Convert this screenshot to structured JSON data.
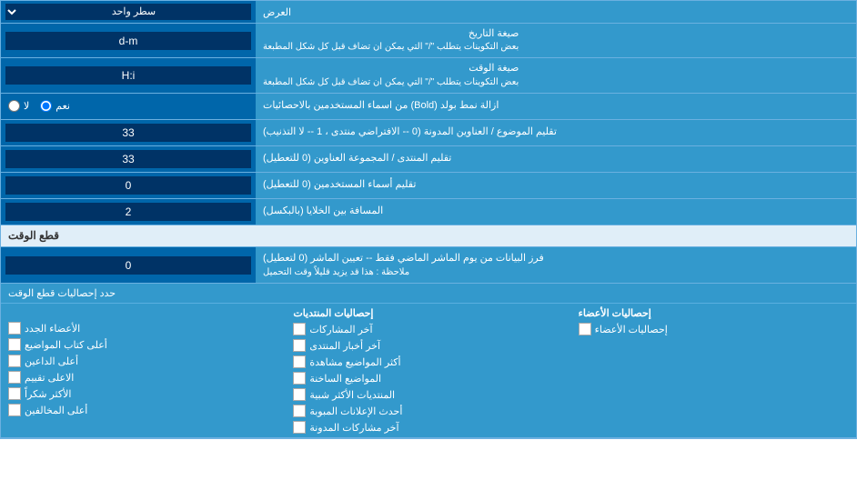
{
  "page": {
    "title": "العرض",
    "rows": [
      {
        "id": "display_mode",
        "label": "العرض",
        "input_type": "select",
        "value": "سطر واحد"
      },
      {
        "id": "date_format",
        "label": "صيغة التاريخ",
        "sublabel": "بعض التكوينات يتطلب \"/\" التي يمكن ان تضاف قبل كل شكل المطبعة",
        "input_type": "text",
        "value": "d-m"
      },
      {
        "id": "time_format",
        "label": "صيغة الوقت",
        "sublabel": "بعض التكوينات يتطلب \"/\" التي يمكن ان تضاف قبل كل شكل المطبعة",
        "input_type": "text",
        "value": "H:i"
      },
      {
        "id": "bold_remove",
        "label": "ازالة نمط بولد (Bold) من اسماء المستخدمين بالاحصائيات",
        "input_type": "radio",
        "options": [
          {
            "value": "yes",
            "label": "نعم",
            "checked": true
          },
          {
            "value": "no",
            "label": "لا",
            "checked": false
          }
        ]
      },
      {
        "id": "topic_truncate",
        "label": "تقليم الموضوع / العناوين المدونة (0 -- الافتراضي منتدى ، 1 -- لا التذنيب)",
        "input_type": "text",
        "value": "33"
      },
      {
        "id": "forum_truncate",
        "label": "تقليم المنتدى / المجموعة العناوين (0 للتعطيل)",
        "input_type": "text",
        "value": "33"
      },
      {
        "id": "user_truncate",
        "label": "تقليم أسماء المستخدمين (0 للتعطيل)",
        "input_type": "text",
        "value": "0"
      },
      {
        "id": "cell_spacing",
        "label": "المسافة بين الخلايا (بالبكسل)",
        "input_type": "text",
        "value": "2"
      }
    ],
    "freeze_section": {
      "header": "قطع الوقت",
      "row": {
        "id": "freeze_days",
        "label": "فرز البيانات من يوم الماشر الماضي فقط -- تعيين الماشر (0 لتعطيل)",
        "note": "ملاحظة : هذا قد يزيد قليلاً وقت التحميل",
        "input_type": "text",
        "value": "0"
      },
      "checkboxes_label": "حدد إحصاليات قطع الوقت",
      "columns": [
        {
          "id": "col1",
          "header": "",
          "items": [
            {
              "id": "chk_new_members",
              "label": "الأعضاء الجدد",
              "checked": false
            },
            {
              "id": "chk_top_posters",
              "label": "أعلى كتاب المواضيع",
              "checked": false
            },
            {
              "id": "chk_top_uploaders",
              "label": "أعلى الداعين",
              "checked": false
            },
            {
              "id": "chk_top_raters",
              "label": "الاعلى تقييم",
              "checked": false
            },
            {
              "id": "chk_most_thanks",
              "label": "الأكثر شكراً",
              "checked": false
            },
            {
              "id": "chk_top_viewers",
              "label": "أعلى المخالفين",
              "checked": false
            }
          ]
        },
        {
          "id": "col2",
          "header": "إحصاليات الأعضاء",
          "items": [
            {
              "id": "chk_last_posts",
              "label": "آخر المشاركات",
              "checked": false
            },
            {
              "id": "chk_last_news",
              "label": "آخر أخبار المنتدى",
              "checked": false
            },
            {
              "id": "chk_most_viewed",
              "label": "أكثر المواضيع مشاهدة",
              "checked": false
            },
            {
              "id": "chk_last_active",
              "label": "المواضيع الساخنة",
              "checked": false
            },
            {
              "id": "chk_similar_forums",
              "label": "المنتديات الأكثر شبية",
              "checked": false
            },
            {
              "id": "chk_recent_ads",
              "label": "أحدث الإعلانات المبوبة",
              "checked": false
            },
            {
              "id": "chk_last_shared",
              "label": "آخر مشاركات المدونة",
              "checked": false
            }
          ]
        },
        {
          "id": "col3",
          "header": "إحصاليات المنتديات",
          "items": [
            {
              "id": "chk_stats_members",
              "label": "إحصاليات الأعضاء",
              "checked": false
            }
          ]
        }
      ]
    }
  }
}
